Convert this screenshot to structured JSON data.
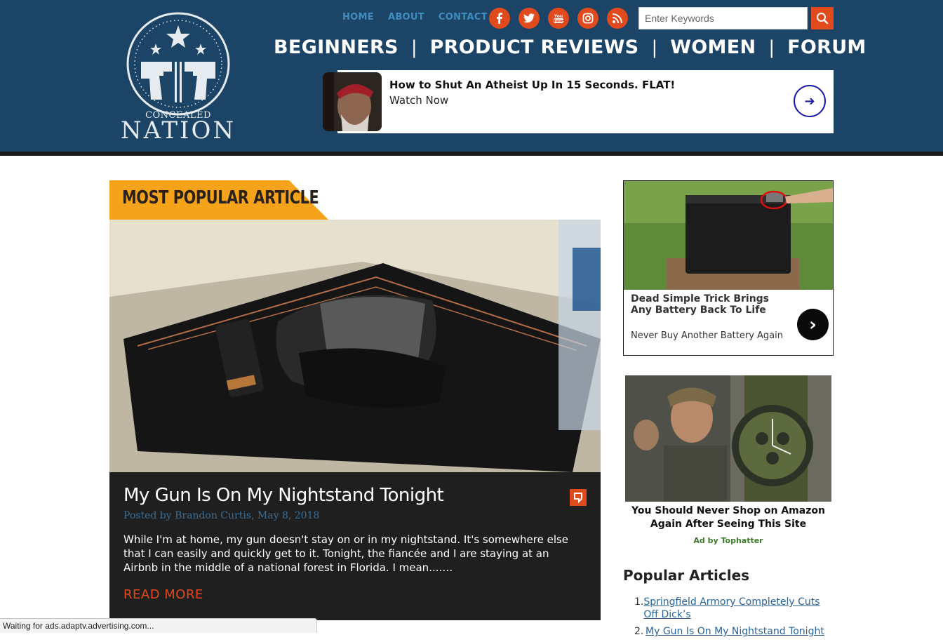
{
  "site": {
    "logo_alt": "Concealed Nation",
    "logo_line1": "CONCEALED",
    "logo_line2": "NATION"
  },
  "top_nav": [
    {
      "label": "HOME"
    },
    {
      "label": "ABOUT"
    },
    {
      "label": "CONTACT"
    }
  ],
  "social_icons": [
    "facebook-icon",
    "twitter-icon",
    "youtube-icon",
    "instagram-icon",
    "rss-icon"
  ],
  "search": {
    "placeholder": "Enter Keywords",
    "value": ""
  },
  "main_nav": [
    {
      "label": "BEGINNERS"
    },
    {
      "label": "PRODUCT REVIEWS"
    },
    {
      "label": "WOMEN"
    },
    {
      "label": "FORUM"
    }
  ],
  "header_ad": {
    "headline": "How to Shut An Atheist Up In 15 Seconds. FLAT!",
    "cta": "Watch Now"
  },
  "feature": {
    "badge": "MOST POPULAR ARTICLE",
    "title": "My Gun Is On My Nightstand Tonight",
    "byline": "Posted by Brandon Curtis, May 8, 2018",
    "excerpt": "While I'm at home, my gun doesn't stay on or in my nightstand. It's somewhere else that I can easily and quickly get to it. Tonight, the fiancée and I are staying at an Airbnb in the middle of a national forest in Florida. I mean....…",
    "read_more": "READ MORE"
  },
  "sidebar_ad1": {
    "headline": "Dead Simple Trick Brings Any Battery Back To Life",
    "sub": "Never Buy Another Battery Again"
  },
  "sidebar_ad2": {
    "headline": "You Should Never Shop on Amazon Again After Seeing This Site",
    "ad_by": "Ad by Tophatter"
  },
  "popular": {
    "title": "Popular Articles",
    "items": [
      {
        "num": "1.",
        "label": "Springfield Armory Completely Cuts Off Dick’s"
      },
      {
        "num": "2.",
        "label": "My Gun Is On My Nightstand Tonight"
      }
    ]
  },
  "status": {
    "text": "Waiting for ads.adaptv.advertising.com..."
  },
  "colors": {
    "header_bg": "#1c4466",
    "accent_orange": "#e14a1d",
    "badge_yellow": "#f5a31a",
    "nav_link_blue": "#3e8ec0",
    "card_bg": "#1f1f1f",
    "byline_blue": "#3b6e97"
  }
}
